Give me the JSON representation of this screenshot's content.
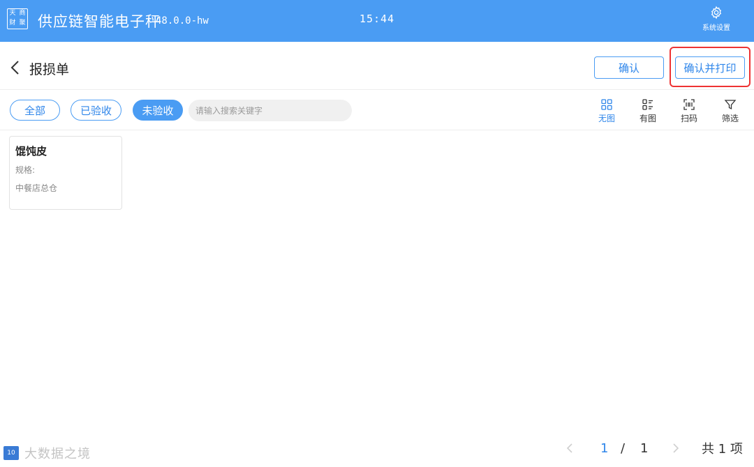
{
  "topbar": {
    "logo_chars": [
      "天",
      "商",
      "财",
      "聚"
    ],
    "app_title": "供应链智能电子秤",
    "version": "48.0.0-hw",
    "time": "15:44",
    "settings_label": "系统设置"
  },
  "header": {
    "title": "报损单",
    "confirm_label": "确认",
    "confirm_print_label": "确认并打印"
  },
  "filters": {
    "all": "全部",
    "received": "已验收",
    "unreceived": "未验收",
    "active": "未验收",
    "search_placeholder": "请输入搜索关键字"
  },
  "tools": {
    "no_image": "无图",
    "with_image": "有图",
    "scan": "扫码",
    "filter": "筛选"
  },
  "items": [
    {
      "name": "馄饨皮",
      "spec": "规格:",
      "store": "中餐店总仓"
    }
  ],
  "footer": {
    "watermark_badge": "10",
    "watermark_text": "大数据之境",
    "current_page": "1",
    "separator": "/",
    "total_pages": "1",
    "total_count": "共 1 项"
  },
  "colors": {
    "primary": "#4a9cf3",
    "highlight": "#e33333"
  }
}
